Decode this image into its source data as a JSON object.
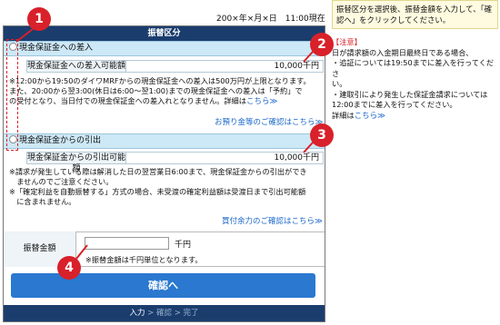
{
  "header": {
    "datetime": "200×年×月×日　11:00現在"
  },
  "panel": {
    "title": "振替区分"
  },
  "deposit": {
    "label": "現金保証金への差入",
    "row_label": "現金保証金への差入可能額",
    "row_value": "10,000千円",
    "note1": "※12:00から19:50のダイワMRFからの現金保証金への差入は500万円が上限となります。",
    "note2": "また、20:00から翌3:00(休日は6:00～翌1:00)までの現金保証金への差入は「予約」で",
    "note3": "の受付となり、当日付での現金保証金への差入れとなりません。詳細は",
    "note_link": "こちら≫",
    "link": "お預り金等のご確認はこちら≫"
  },
  "withdraw": {
    "label": "現金保証金からの引出",
    "row_label": "現金保証金からの引出可能額",
    "row_value": "10,000千円",
    "note1": "※請求が発生している際は解消した日の翌営業日6:00まで、現金保証金からの引出ができ",
    "note2": "　ませんのでご注意ください。",
    "note3": "※「確定利益を自動振替する」方式の場合、未受渡の確定利益額は受渡日まで引出可能額",
    "note4": "　に含まれません。",
    "link": "買付余力のご確認はこちら≫"
  },
  "amount": {
    "label": "振替金額",
    "input_value": "",
    "unit": "千円",
    "hint": "※振替金額は千円単位となります。"
  },
  "confirm_button": "確認へ",
  "steps": {
    "input": "入力",
    "sep1": " > ",
    "confirm": "確認",
    "sep2": " > ",
    "done": "完了"
  },
  "tip": {
    "text": "振替区分を選択後、振替金額を入力して、「確認へ」をクリックしてください。"
  },
  "notice": {
    "head": "【注意】",
    "line1": "日が請求額の入金期日最終日である場合、",
    "line2": "・追証については19:50までに差入を行ってくださ",
    "line3": "い。",
    "line4": "・建取引により発生した保証金請求については",
    "line5": "12:00までに差入を行ってください。",
    "line6": "詳細は",
    "link": "こちら≫"
  },
  "badges": [
    "1",
    "2",
    "3",
    "4"
  ],
  "colors": {
    "accent_red": "#d8212a",
    "navy": "#1a3d6e",
    "button_blue": "#2a78cf",
    "section_blue": "#cde8f6",
    "link_blue": "#1a66c9"
  }
}
